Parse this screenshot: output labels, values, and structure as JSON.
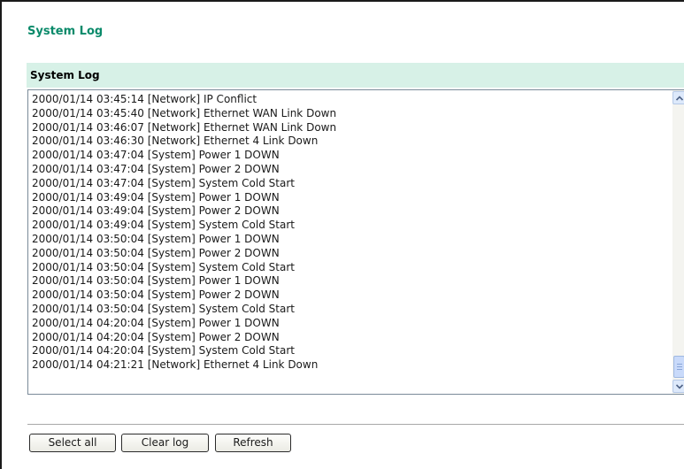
{
  "page": {
    "title": "System Log"
  },
  "section": {
    "header": "System Log"
  },
  "log": {
    "entries": [
      "2000/01/14 03:45:14 [Network] IP Conflict",
      "2000/01/14 03:45:40 [Network] Ethernet WAN Link Down",
      "2000/01/14 03:46:07 [Network] Ethernet WAN Link Down",
      "2000/01/14 03:46:30 [Network] Ethernet 4 Link Down",
      "2000/01/14 03:47:04 [System] Power 1 DOWN",
      "2000/01/14 03:47:04 [System] Power 2 DOWN",
      "2000/01/14 03:47:04 [System] System Cold Start",
      "2000/01/14 03:49:04 [System] Power 1 DOWN",
      "2000/01/14 03:49:04 [System] Power 2 DOWN",
      "2000/01/14 03:49:04 [System] System Cold Start",
      "2000/01/14 03:50:04 [System] Power 1 DOWN",
      "2000/01/14 03:50:04 [System] Power 2 DOWN",
      "2000/01/14 03:50:04 [System] System Cold Start",
      "2000/01/14 03:50:04 [System] Power 1 DOWN",
      "2000/01/14 03:50:04 [System] Power 2 DOWN",
      "2000/01/14 03:50:04 [System] System Cold Start",
      "2000/01/14 04:20:04 [System] Power 1 DOWN",
      "2000/01/14 04:20:04 [System] Power 2 DOWN",
      "2000/01/14 04:20:04 [System] System Cold Start",
      "2000/01/14 04:21:21 [Network] Ethernet 4 Link Down"
    ]
  },
  "actions": {
    "select_all": "Select all",
    "clear_log": "Clear log",
    "refresh": "Refresh"
  },
  "colors": {
    "title": "#0a8a6a",
    "header_bg": "#d7f1e7"
  },
  "icons": {
    "scroll_up": "chevron-up-icon",
    "scroll_down": "chevron-down-icon"
  }
}
